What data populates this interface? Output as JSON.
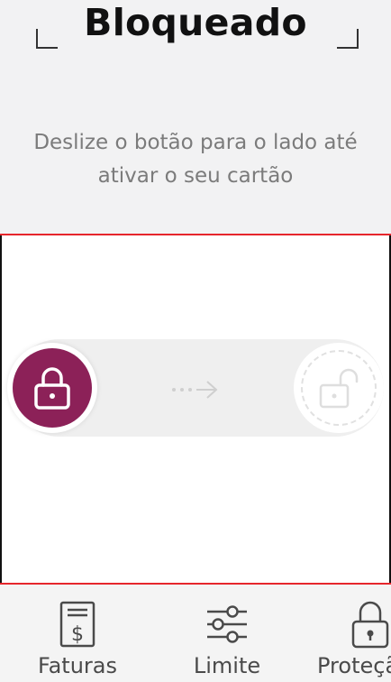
{
  "header": {
    "title": "Bloqueado",
    "instruction_line1": "Deslize o botão para o lado até",
    "instruction_line2": "ativar o seu cartão"
  },
  "slider": {
    "knob_icon": "lock-closed-icon",
    "target_icon": "lock-open-icon",
    "hint_icon": "dotted-arrow-right-icon",
    "knob_color": "#8c2158"
  },
  "bottom_nav": {
    "items": [
      {
        "label": "Faturas",
        "icon": "invoice-dollar-icon"
      },
      {
        "label": "Limite",
        "icon": "sliders-icon"
      },
      {
        "label": "Proteção",
        "icon": "lock-icon"
      }
    ]
  },
  "colors": {
    "accent_red": "#e6262c",
    "brand_purple": "#8c2158",
    "background_top": "#f2f2f3"
  }
}
